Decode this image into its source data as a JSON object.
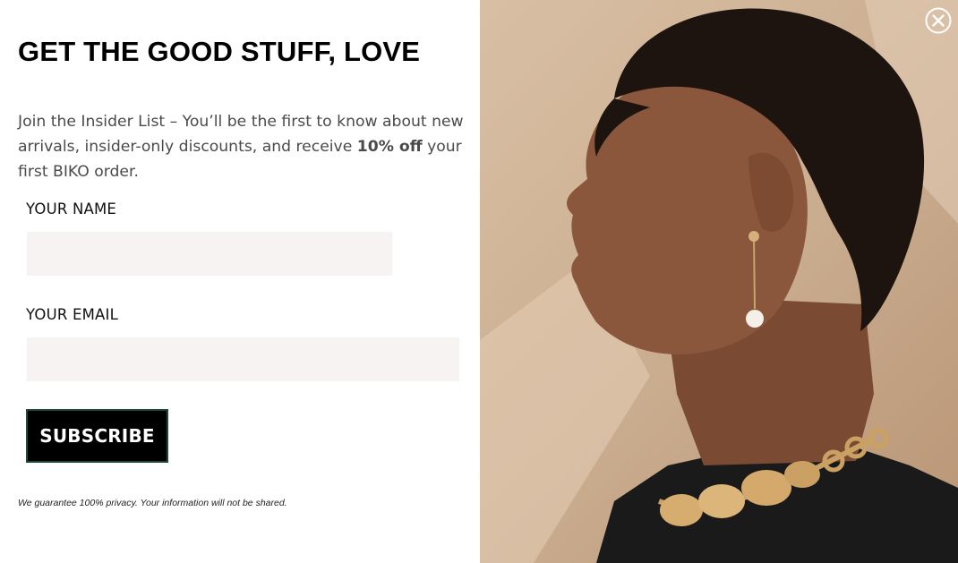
{
  "popup": {
    "headline": "GET THE GOOD STUFF, LOVE",
    "intro_text": "Join the Insider List – You’ll be the first to know about new arrivals, insider-only discounts, and receive ",
    "intro_bold": "10% off",
    "intro_end": " your first BIKO order.",
    "name_label": "YOUR NAME",
    "name_value": "",
    "email_label": "YOUR EMAIL",
    "email_value": "",
    "subscribe_label": "SUBSCRIBE",
    "privacy_note": "We guarantee 100% privacy. Your information will not be shared."
  },
  "photo": {
    "icon": "product-model-photo"
  },
  "close": {
    "icon": "close-icon"
  },
  "colors": {
    "button_bg": "#000000",
    "button_border": "#1f4a3a",
    "input_bg": "#f6f3f2",
    "photo_bg": "#d2b698"
  }
}
